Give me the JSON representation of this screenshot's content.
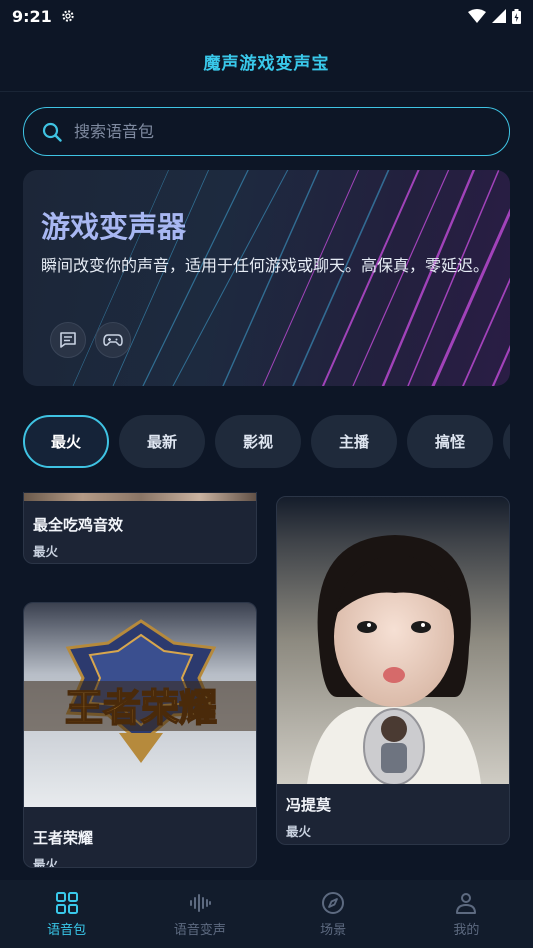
{
  "status_bar": {
    "time": "9:21"
  },
  "header": {
    "title": "魔声游戏变声宝"
  },
  "search": {
    "placeholder": "搜索语音包"
  },
  "hero": {
    "title": "游戏变声器",
    "description": "瞬间改变你的声音，适用于任何游戏或聊天。高保真，零延迟。"
  },
  "categories": [
    {
      "label": "最火",
      "active": true
    },
    {
      "label": "最新",
      "active": false
    },
    {
      "label": "影视",
      "active": false
    },
    {
      "label": "主播",
      "active": false
    },
    {
      "label": "搞怪",
      "active": false
    }
  ],
  "cards": [
    {
      "title": "最全吃鸡音效",
      "tag": "最火"
    },
    {
      "title": "王者荣耀",
      "tag": "最火",
      "image_text": "王者荣耀"
    },
    {
      "title": "冯提莫",
      "tag": "最火"
    }
  ],
  "bottom_nav": [
    {
      "label": "语音包",
      "icon": "grid-icon",
      "active": true
    },
    {
      "label": "语音变声",
      "icon": "waveform-icon",
      "active": false
    },
    {
      "label": "场景",
      "icon": "compass-icon",
      "active": false
    },
    {
      "label": "我的",
      "icon": "person-icon",
      "active": false
    }
  ],
  "colors": {
    "accent": "#39c8ea",
    "background": "#0d1626",
    "card": "#1c2435"
  }
}
